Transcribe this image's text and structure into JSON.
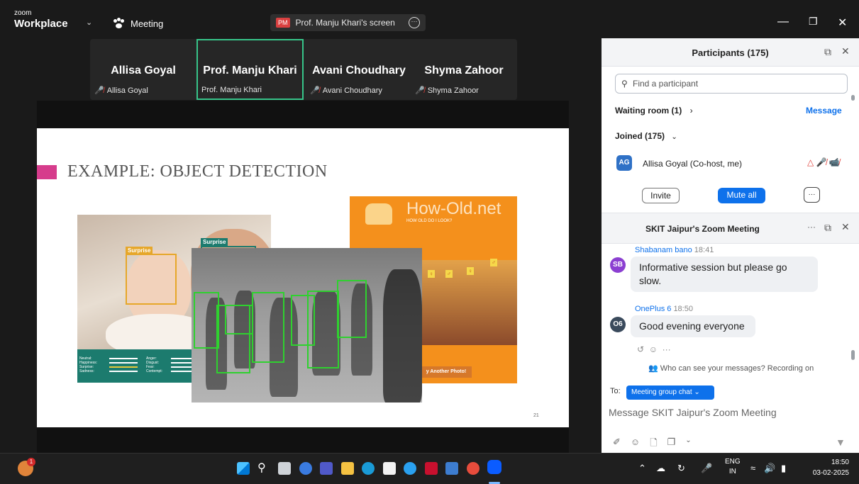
{
  "topbar": {
    "brand_small": "zoom",
    "brand_big": "Workplace",
    "meeting_label": "Meeting",
    "screen_initials": "PM",
    "screen_label": "Prof. Manju Khari's screen"
  },
  "video_tiles": [
    {
      "name": "Allisa Goyal",
      "label": "Allisa Goyal"
    },
    {
      "name": "Prof. Manju Khari",
      "label": "Prof. Manju Khari"
    },
    {
      "name": "Avani Choudhary",
      "label": "Avani Choudhary"
    },
    {
      "name": "Shyma Zahoor",
      "label": "Shyma Zahoor"
    }
  ],
  "slide": {
    "title": "EXAMPLE: OBJECT DETECTION",
    "page_number": "21",
    "tag_surprise": "Surprise",
    "tag_surprise2": "Surprise",
    "panel_left": "Neutral:\nHappiness:\nSurprise:\nSadness:",
    "panel_mid": "Anger:\nDisgust:\nFear:\nContempt:",
    "howold_title": "How-Old.net",
    "howold_sub": "HOW OLD DO I LOOK?",
    "howold_btn": "y Another Photo!"
  },
  "participants": {
    "title": "Participants (175)",
    "search_placeholder": "Find a participant",
    "waiting_room": "Waiting room (1)",
    "message_link": "Message",
    "joined": "Joined (175)",
    "self_initials": "AG",
    "self_name": "Allisa Goyal (Co-host, me)",
    "invite": "Invite",
    "mute_all": "Mute all"
  },
  "chat": {
    "title": "SKIT Jaipur's Zoom Meeting",
    "messages": [
      {
        "initials": "SB",
        "sender": "Shabanam bano",
        "time": "18:41",
        "text": "Informative session but please go slow."
      },
      {
        "initials": "O6",
        "sender": "OnePlus 6",
        "time": "18:50",
        "text": "Good evening everyone"
      }
    ],
    "privacy_note": "Who can see your messages? Recording on",
    "to_label": "To:",
    "to_target": "Meeting group chat",
    "placeholder": "Message SKIT Jaipur's Zoom Meeting"
  },
  "taskbar": {
    "notification_count": "1",
    "lang_line1": "ENG",
    "lang_line2": "IN",
    "time": "18:50",
    "date": "03-02-2025"
  },
  "colors": {
    "zoom_blue": "#0e71eb",
    "active_tile_border": "#37c58a",
    "slide_accent": "#d63c8c",
    "mic_off": "#e0403a"
  }
}
